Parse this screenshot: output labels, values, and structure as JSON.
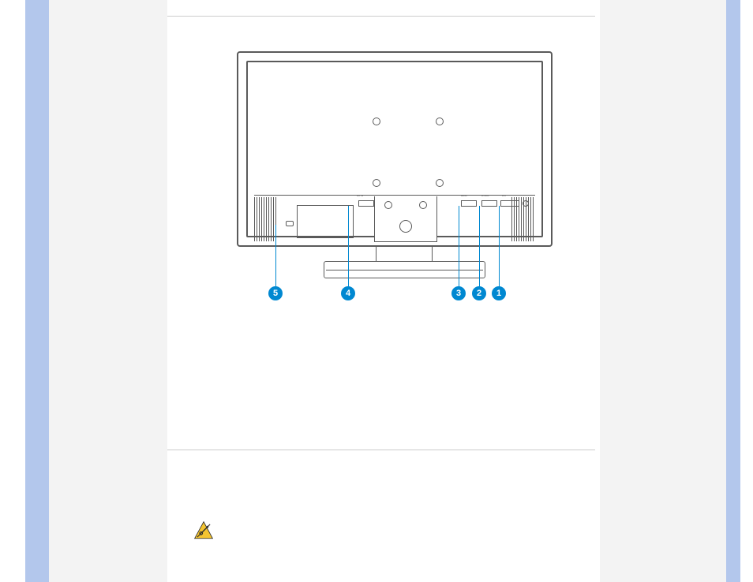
{
  "page": {
    "section_divider_top": true,
    "section_divider_bottom": true
  },
  "figure": {
    "caption": "",
    "port_labels": {
      "ac": "AC IN",
      "hdmi": "HDMI",
      "dsub": "D-SUB",
      "dvi": "DVI",
      "audio": ""
    },
    "callouts": [
      {
        "id": 1,
        "label": "1"
      },
      {
        "id": 2,
        "label": "2"
      },
      {
        "id": 3,
        "label": "3"
      },
      {
        "id": 4,
        "label": "4"
      },
      {
        "id": 5,
        "label": "5"
      }
    ]
  },
  "note": {
    "icon": "warning-triangle",
    "text": ""
  }
}
